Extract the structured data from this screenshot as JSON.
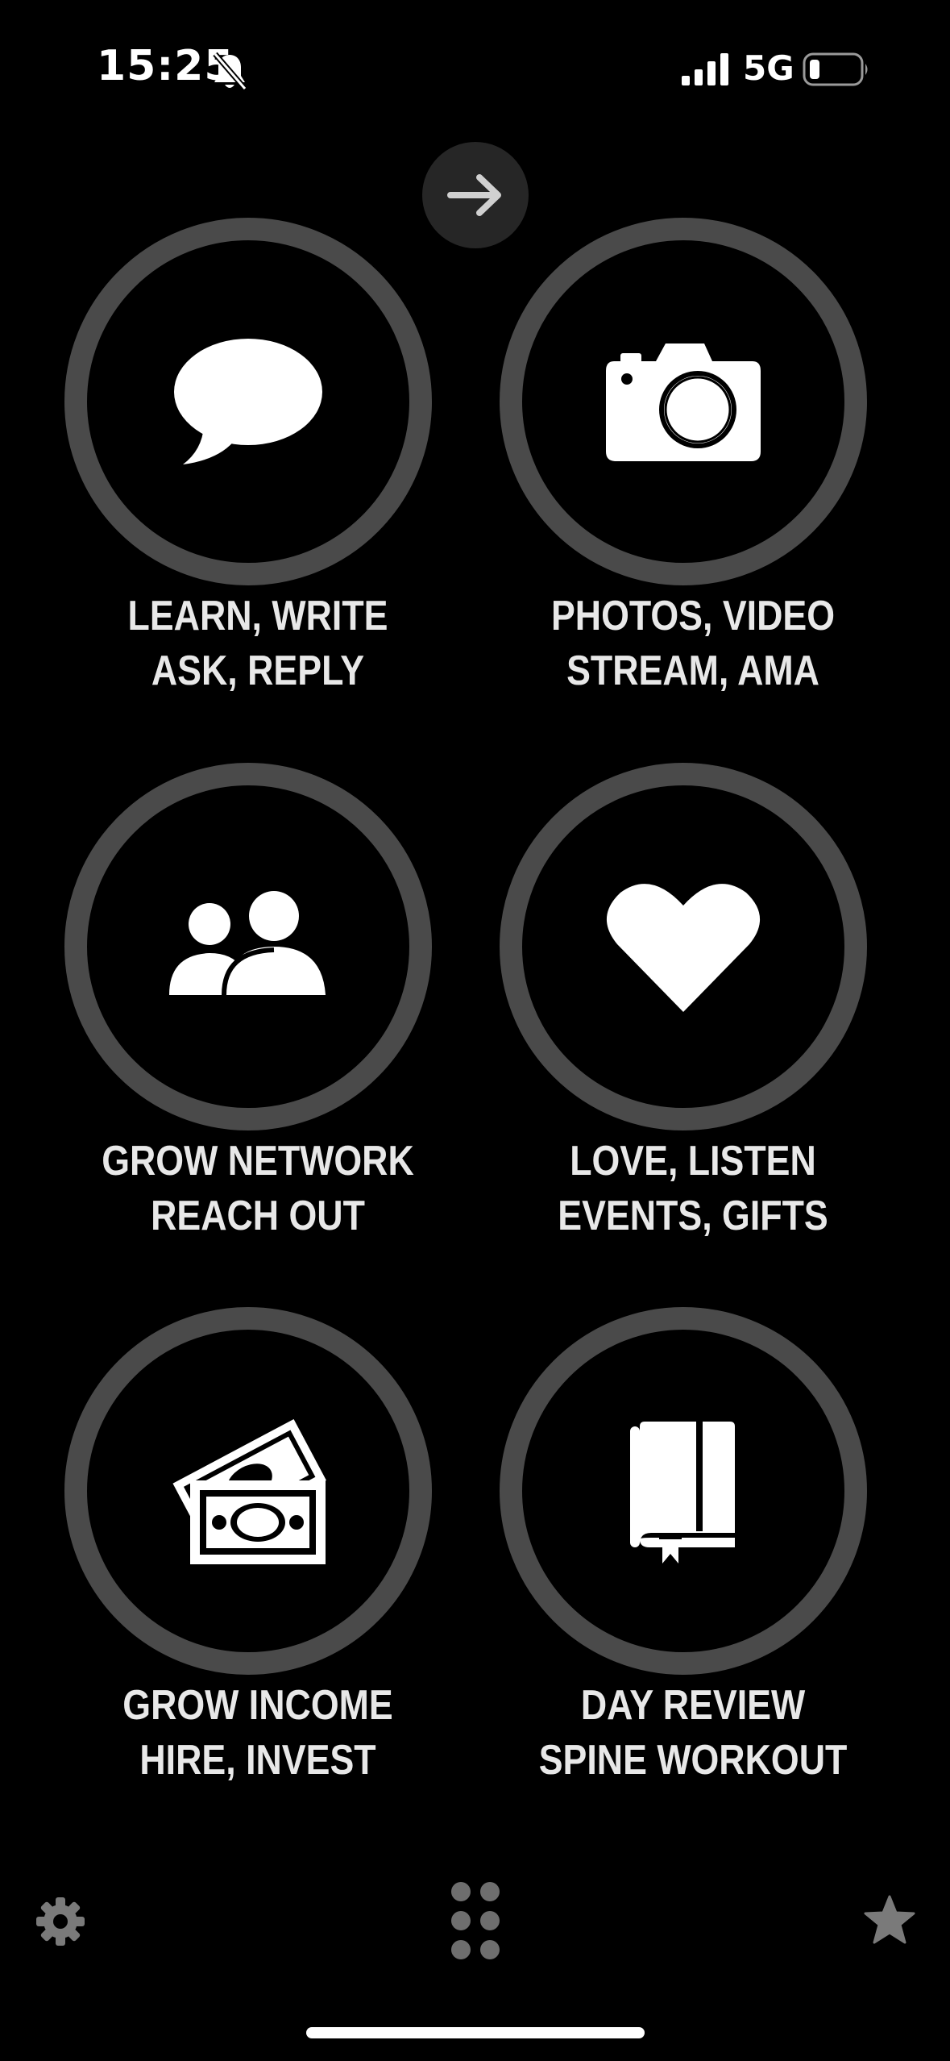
{
  "status_bar": {
    "time": "15:25",
    "network": "5G",
    "icons": [
      "bell-slash-icon",
      "signal-bars-icon",
      "battery-low-icon"
    ]
  },
  "top": {
    "arrow_icon": "arrow-right-icon"
  },
  "tiles": [
    {
      "icon": "chat-bubble-icon",
      "line1": "LEARN, WRITE",
      "line2": "ASK, REPLY"
    },
    {
      "icon": "camera-icon",
      "line1": "PHOTOS, VIDEO",
      "line2": "STREAM, AMA"
    },
    {
      "icon": "people-icon",
      "line1": "GROW NETWORK",
      "line2": "REACH OUT"
    },
    {
      "icon": "heart-icon",
      "line1": "LOVE, LISTEN",
      "line2": "EVENTS, GIFTS"
    },
    {
      "icon": "money-icon",
      "line1": "GROW INCOME",
      "line2": "HIRE, INVEST"
    },
    {
      "icon": "book-icon",
      "line1": "DAY REVIEW",
      "line2": "SPINE WORKOUT"
    }
  ],
  "bottom_bar": {
    "icons": [
      "gear-icon",
      "apps-grid-icon",
      "star-icon"
    ]
  },
  "colors": {
    "background": "#000000",
    "ring": "#4a4a4a",
    "label": "#e8e8e8",
    "icon": "#ffffff",
    "muted_icon": "#7a7a7a"
  }
}
